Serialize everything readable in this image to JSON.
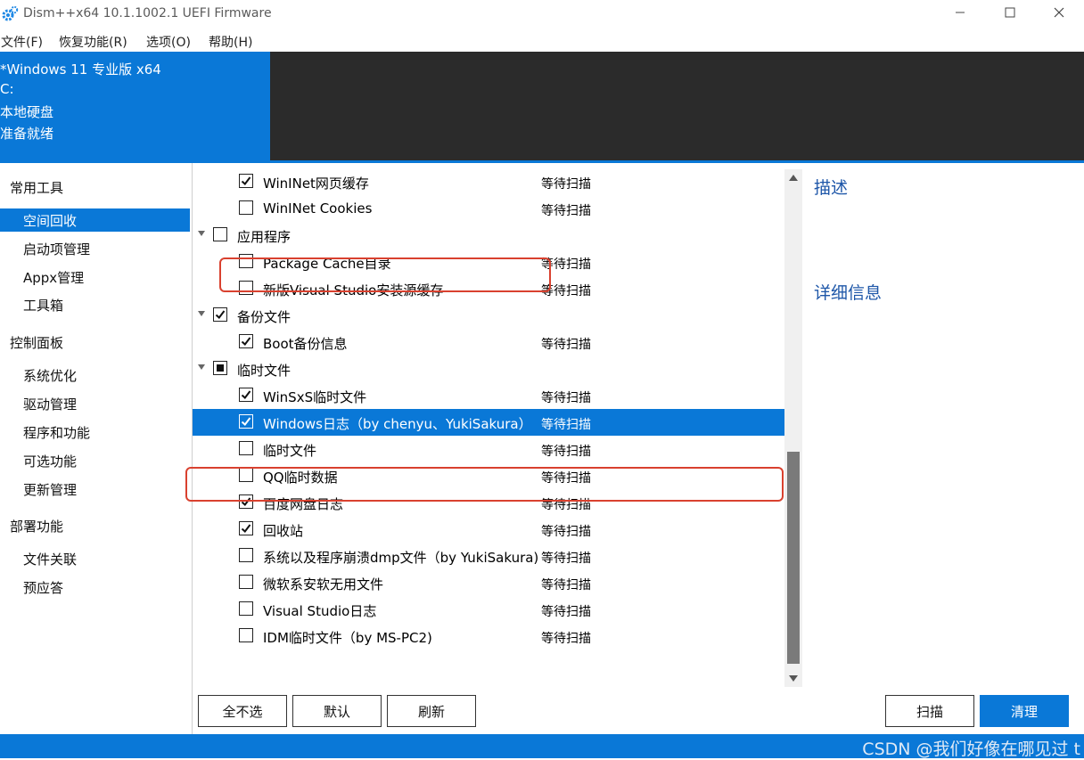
{
  "window": {
    "title": "Dism++x64 10.1.1002.1 UEFI Firmware",
    "icon": "gear-icon",
    "controls": [
      "minimize-icon",
      "maximize-icon",
      "close-icon"
    ]
  },
  "menu": [
    "文件(F)",
    "恢复功能(R)",
    "选项(O)",
    "帮助(H)"
  ],
  "os_info": {
    "name": "*Windows 11 专业版 x64",
    "drive": "C:",
    "disk_type": "本地硬盘",
    "status": "准备就绪"
  },
  "sidebar": {
    "groups": [
      {
        "title": "常用工具",
        "items": [
          {
            "label": "空间回收",
            "active": true
          },
          {
            "label": "启动项管理"
          },
          {
            "label": "Appx管理"
          },
          {
            "label": "工具箱"
          }
        ]
      },
      {
        "title": "控制面板",
        "items": [
          {
            "label": "系统优化"
          },
          {
            "label": "驱动管理"
          },
          {
            "label": "程序和功能"
          },
          {
            "label": "可选功能"
          },
          {
            "label": "更新管理"
          }
        ]
      },
      {
        "title": "部署功能",
        "items": [
          {
            "label": "文件关联"
          },
          {
            "label": "预应答"
          }
        ]
      }
    ]
  },
  "list": {
    "rows": [
      {
        "type": "item",
        "label": "WinINet网页缓存",
        "checked": true,
        "status": "等待扫描"
      },
      {
        "type": "item",
        "label": "WinINet Cookies",
        "checked": false,
        "status": "等待扫描"
      },
      {
        "type": "group",
        "label": "应用程序",
        "state": "unchecked"
      },
      {
        "type": "item",
        "label": "Package Cache目录",
        "checked": false,
        "status": "等待扫描"
      },
      {
        "type": "item",
        "label": "新版Visual Studio安装源缓存",
        "checked": false,
        "status": "等待扫描"
      },
      {
        "type": "group",
        "label": "备份文件",
        "state": "checked"
      },
      {
        "type": "item",
        "label": "Boot备份信息",
        "checked": true,
        "status": "等待扫描"
      },
      {
        "type": "group",
        "label": "临时文件",
        "state": "partial"
      },
      {
        "type": "item",
        "label": "WinSxS临时文件",
        "checked": true,
        "status": "等待扫描"
      },
      {
        "type": "item",
        "label": "Windows日志（by chenyu、YukiSakura）",
        "checked": true,
        "status": "等待扫描",
        "selected": true
      },
      {
        "type": "item",
        "label": "临时文件",
        "checked": false,
        "status": "等待扫描"
      },
      {
        "type": "item",
        "label": "QQ临时数据",
        "checked": false,
        "status": "等待扫描"
      },
      {
        "type": "item",
        "label": "百度网盘日志",
        "checked": true,
        "status": "等待扫描"
      },
      {
        "type": "item",
        "label": "回收站",
        "checked": true,
        "status": "等待扫描"
      },
      {
        "type": "item",
        "label": "系统以及程序崩溃dmp文件（by YukiSakura)",
        "checked": false,
        "status": "等待扫描"
      },
      {
        "type": "item",
        "label": "微软系安软无用文件",
        "checked": false,
        "status": "等待扫描"
      },
      {
        "type": "item",
        "label": "Visual Studio日志",
        "checked": false,
        "status": "等待扫描"
      },
      {
        "type": "item",
        "label": "IDM临时文件（by MS-PC2)",
        "checked": false,
        "status": "等待扫描"
      }
    ]
  },
  "right_panel": {
    "description_title": "描述",
    "details_title": "详细信息"
  },
  "buttons": {
    "deselect_all": "全不选",
    "default": "默认",
    "refresh": "刷新",
    "scan": "扫描",
    "clean": "清理"
  },
  "watermark": "CSDN @我们好像在哪见过 t",
  "colors": {
    "accent": "#0a78d7",
    "highlight": "#d9412f",
    "dark_panel": "#2b2b2b",
    "link": "#1d56a8"
  }
}
